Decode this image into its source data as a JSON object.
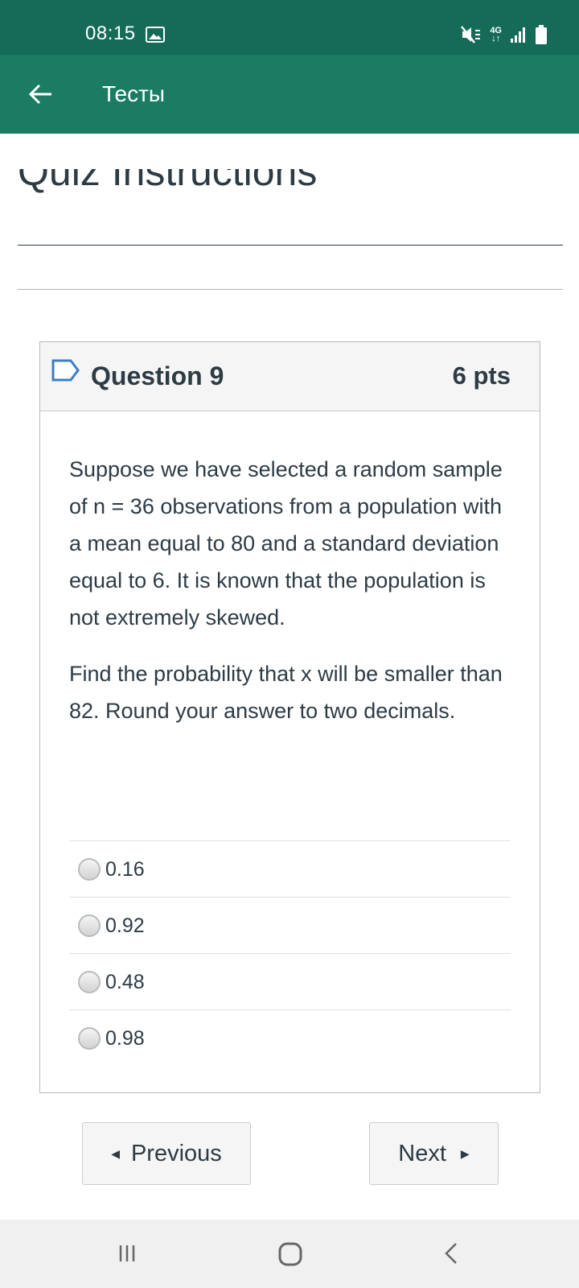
{
  "status_bar": {
    "time": "08:15",
    "network": "4G",
    "icons": [
      "image-notification-icon",
      "mute-icon",
      "network-4g-icon",
      "signal-icon",
      "battery-icon"
    ]
  },
  "app_bar": {
    "title": "Тесты",
    "back_icon": "arrow-back-icon"
  },
  "page": {
    "heading": "Quiz Instructions"
  },
  "question": {
    "title": "Question 9",
    "points": "6 pts",
    "paragraphs": [
      "Suppose we have selected a random sample of n = 36 observations from a population with a mean equal to 80 and a standard deviation equal to 6. It is known that the population is not extremely skewed.",
      "Find the probability that x will be smaller than 82. Round your answer to two decimals."
    ],
    "answers": [
      "0.16",
      "0.92",
      "0.48",
      "0.98"
    ]
  },
  "navigation": {
    "previous_label": "Previous",
    "next_label": "Next"
  },
  "system_nav": {
    "icons": [
      "recent-apps-icon",
      "home-icon",
      "back-icon"
    ]
  },
  "colors": {
    "status_bar": "#166b58",
    "app_bar": "#1b7c63",
    "text": "#2d3b45",
    "header_bg": "#f5f5f5"
  }
}
